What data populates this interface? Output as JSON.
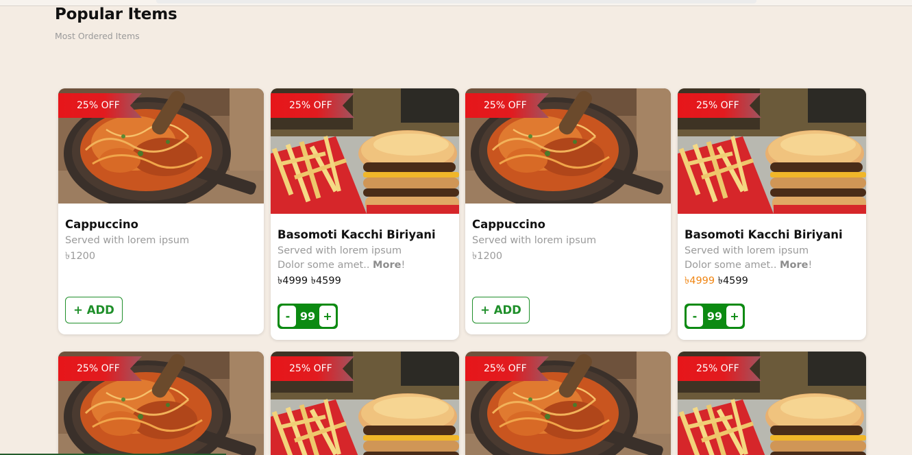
{
  "section": {
    "title": "Popular Items",
    "subtitle": "Most Ordered Items"
  },
  "currency": "৳",
  "colors": {
    "page_bg": "#f4ece3",
    "discount_ribbon": "#e6161a",
    "accent_green": "#0c8a12",
    "old_price_orange": "#f08512"
  },
  "cards": [
    {
      "image": "noodles-bowl",
      "discount": "25% OFF",
      "name": "Cappuccino",
      "desc": "Served with lorem ipsum",
      "price": "৳1200",
      "button": "+ ADD"
    },
    {
      "image": "burger-fries",
      "discount": "25% OFF",
      "name": "Basomoti Kacchi Biriyani",
      "desc": "Served with lorem ipsum",
      "desc2": "Dolor some amet..",
      "more": "More",
      "more_suffix": "!",
      "old_price": "৳4999",
      "new_price": "৳4599",
      "minus": "-",
      "qty": "99",
      "plus": "+"
    },
    {
      "image": "noodles-bowl",
      "discount": "25% OFF",
      "name": "Cappuccino",
      "desc": "Served with lorem ipsum",
      "price": "৳1200",
      "button": "+ ADD"
    },
    {
      "image": "burger-fries",
      "discount": "25% OFF",
      "name": "Basomoti Kacchi Biriyani",
      "desc": "Served with lorem ipsum",
      "desc2": "Dolor some amet..",
      "more": "More",
      "more_suffix": "!",
      "old_price": "৳4999",
      "new_price": "৳4599",
      "minus": "-",
      "qty": "99",
      "plus": "+"
    }
  ],
  "row2": [
    {
      "image": "noodles-bowl",
      "discount": "25% OFF"
    },
    {
      "image": "burger-fries",
      "discount": "25% OFF"
    },
    {
      "image": "noodles-bowl",
      "discount": "25% OFF"
    },
    {
      "image": "burger-fries",
      "discount": "25% OFF"
    }
  ]
}
